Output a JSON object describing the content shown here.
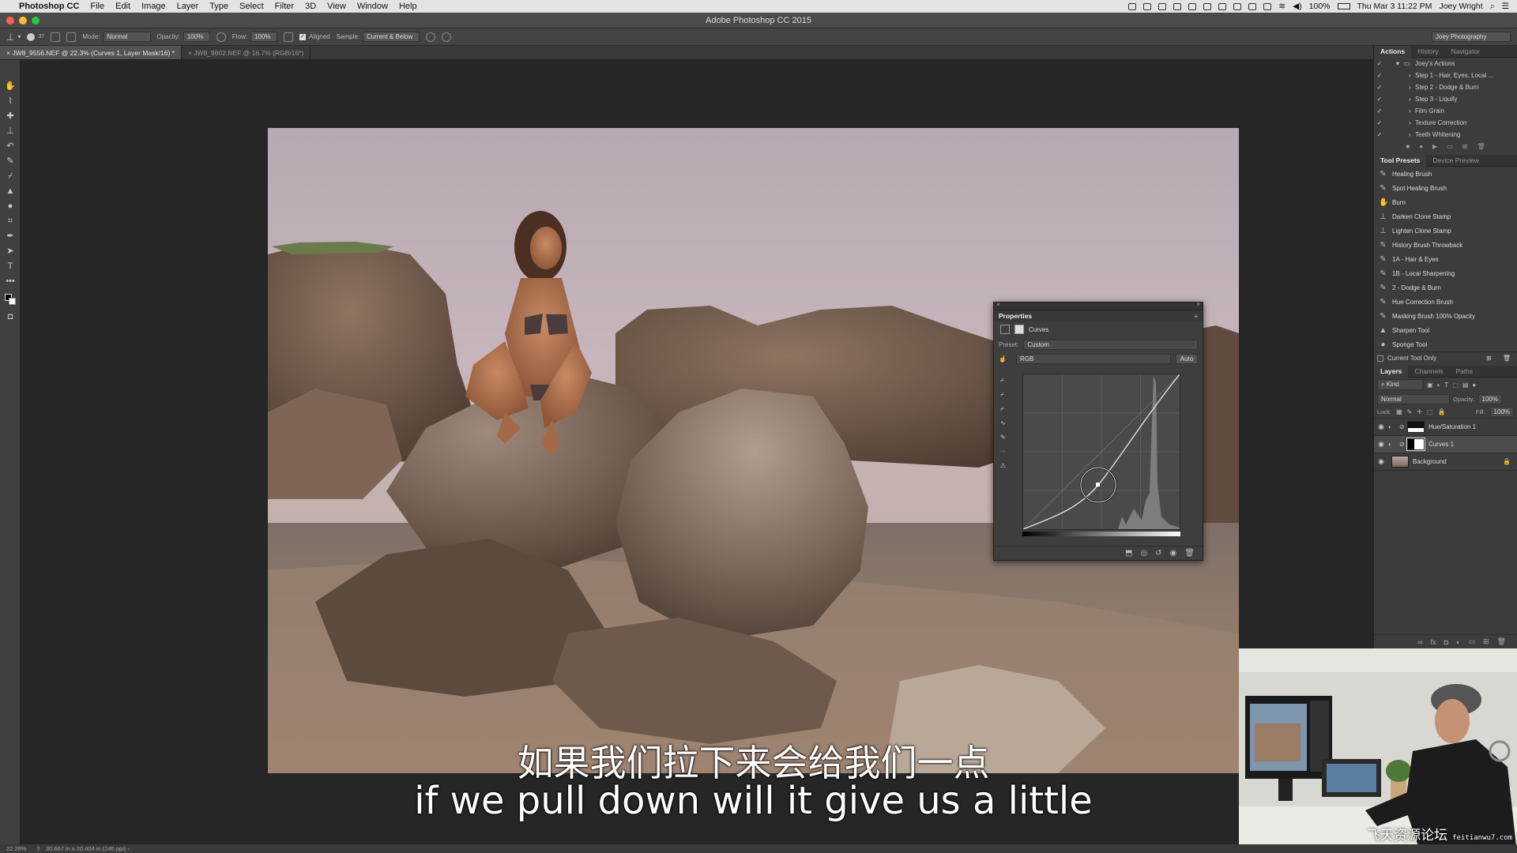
{
  "menubar": {
    "app_name": "Photoshop CC",
    "menus": [
      "File",
      "Edit",
      "Image",
      "Layer",
      "Type",
      "Select",
      "Filter",
      "3D",
      "View",
      "Window",
      "Help"
    ],
    "battery": "100%",
    "clock": "Thu Mar 3  11:22 PM",
    "user": "Joey Wright"
  },
  "window": {
    "title": "Adobe Photoshop CC 2015"
  },
  "options_bar": {
    "mode_label": "Mode:",
    "mode_value": "Normal",
    "opacity_label": "Opacity:",
    "opacity_value": "100%",
    "flow_label": "Flow:",
    "flow_value": "100%",
    "aligned_label": "Aligned",
    "sample_label": "Sample:",
    "sample_value": "Current & Below",
    "workspace": "Joey Photography",
    "brush_size": "37"
  },
  "doc_tabs": [
    {
      "label": "JW8_9556.NEF @ 22.3% (Curves 1, Layer Mask/16) *",
      "active": true
    },
    {
      "label": "JW8_9602.NEF @ 16.7% (RGB/16*)",
      "active": false
    }
  ],
  "actions_panel": {
    "tabs": [
      "Actions",
      "History",
      "Navigator"
    ],
    "set_name": "Joey's Actions",
    "items": [
      "Step 1 - Hair, Eyes, Local ...",
      "Step 2 - Dodge & Burn",
      "Step 3 - Liquify",
      "Film Grain",
      "Texture Correction",
      "Teeth Whitening"
    ]
  },
  "tool_presets_panel": {
    "tabs": [
      "Tool Presets",
      "Device Preview"
    ],
    "items": [
      "Healing Brush",
      "Spot Healing Brush",
      "Burn",
      "Darken Clone Stamp",
      "Lighten Clone Stamp",
      "History Brush Throwback",
      "1A - Hair & Eyes",
      "1B - Local Sharpening",
      "2 - Dodge & Burn",
      "Hue Correction Brush",
      "Masking Brush 100% Opacity",
      "Sharpen Tool",
      "Sponge Tool"
    ],
    "current_tool_only": "Current Tool Only"
  },
  "layers_panel": {
    "tabs": [
      "Layers",
      "Channels",
      "Paths"
    ],
    "kind_label": "Kind",
    "blend_mode": "Normal",
    "opacity_label": "Opacity:",
    "opacity_value": "100%",
    "lock_label": "Lock:",
    "fill_label": "Fill:",
    "fill_value": "100%",
    "layers": [
      {
        "name": "Hue/Saturation 1",
        "selected": false
      },
      {
        "name": "Curves 1",
        "selected": true
      },
      {
        "name": "Background",
        "selected": false
      }
    ]
  },
  "properties_panel": {
    "title": "Properties",
    "adjustment": "Curves",
    "preset_label": "Preset:",
    "preset_value": "Custom",
    "channel_value": "RGB",
    "auto_label": "Auto"
  },
  "status_bar": {
    "zoom": "22.26%",
    "doc_info": "30.667 in x 20.404 in (240 ppi)"
  },
  "subtitles": {
    "chinese": "如果我们拉下来会给我们一点",
    "english": "if we pull down will it give us a little"
  },
  "watermark": {
    "site": "飞天资源论坛",
    "url": "feitianwu7.com"
  },
  "colors": {
    "accent": "#4a90d9",
    "panel_bg": "#3c3c3c",
    "canvas_bg": "#262626"
  }
}
